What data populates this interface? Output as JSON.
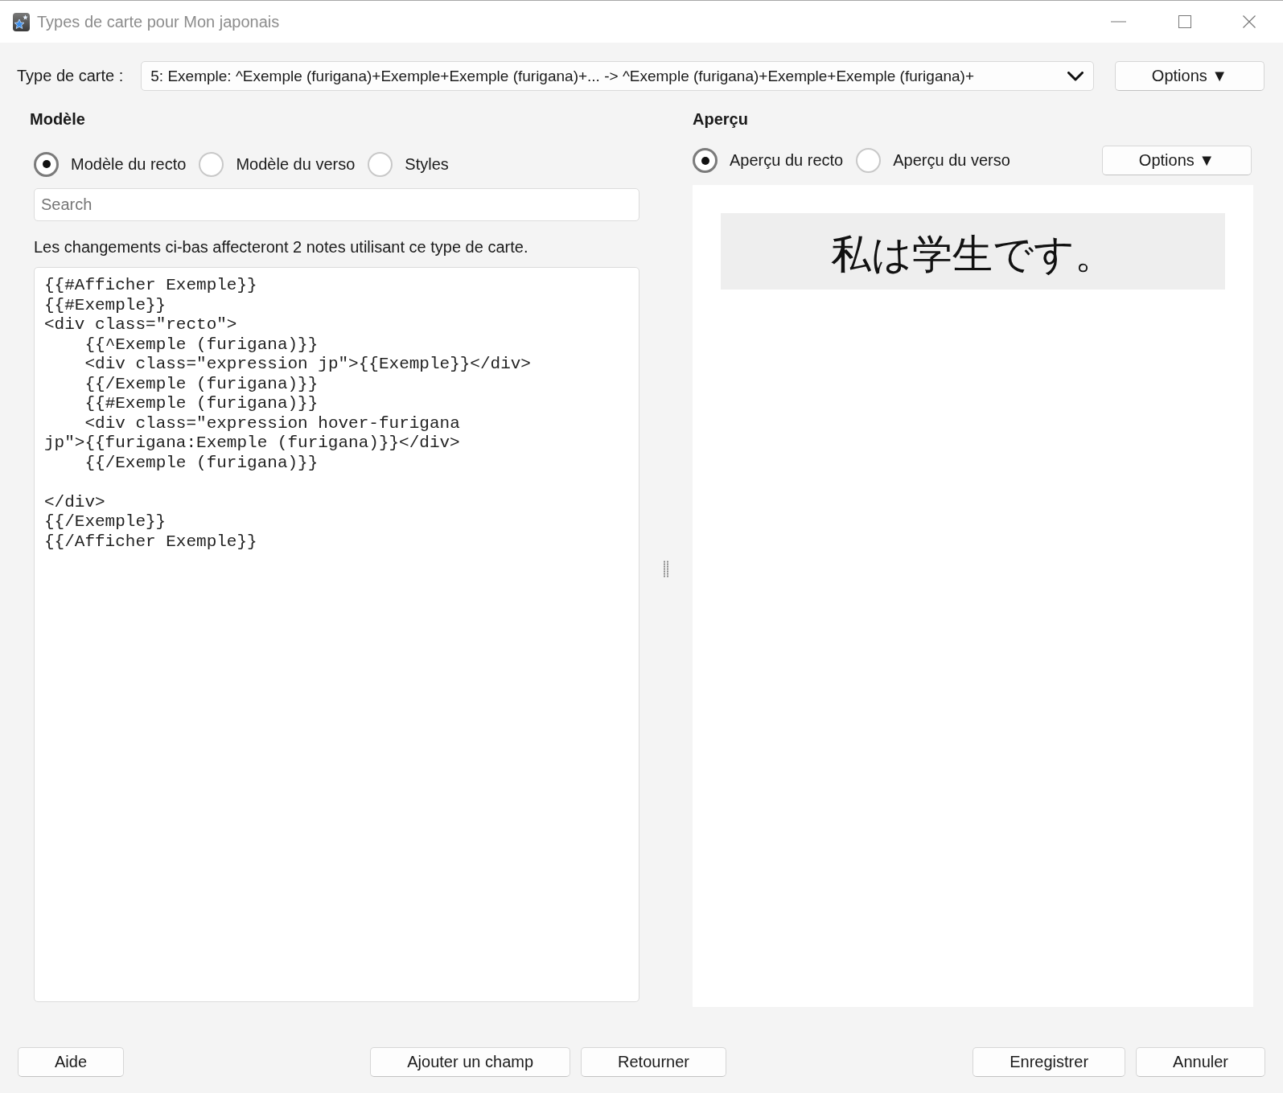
{
  "window": {
    "title": "Types de carte pour Mon japonais"
  },
  "card_type": {
    "label": "Type de carte :",
    "value": "5: Exemple: ^Exemple (furigana)+Exemple+Exemple (furigana)+... -> ^Exemple (furigana)+Exemple+Exemple (furigana)+",
    "options_button": "Options ▼"
  },
  "template": {
    "heading": "Modèle",
    "radios": [
      {
        "label": "Modèle du recto",
        "selected": true
      },
      {
        "label": "Modèle du verso",
        "selected": false
      },
      {
        "label": "Styles",
        "selected": false
      }
    ],
    "search": {
      "placeholder": "Search"
    },
    "notice": "Les changements ci-bas affecteront 2 notes utilisant ce type de carte.",
    "code": "{{#Afficher Exemple}}\n{{#Exemple}}\n<div class=\"recto\">\n    {{^Exemple (furigana)}}\n    <div class=\"expression jp\">{{Exemple}}</div>\n    {{/Exemple (furigana)}}\n    {{#Exemple (furigana)}}\n    <div class=\"expression hover-furigana jp\">{{furigana:Exemple (furigana)}}</div>\n    {{/Exemple (furigana)}}\n\n</div>\n{{/Exemple}}\n{{/Afficher Exemple}}"
  },
  "preview": {
    "heading": "Aperçu",
    "radios": [
      {
        "label": "Aperçu du recto",
        "selected": true
      },
      {
        "label": "Aperçu du verso",
        "selected": false
      }
    ],
    "options_button": "Options ▼",
    "card_text": "私は学生です。"
  },
  "footer": {
    "left": [
      "Aide"
    ],
    "center": [
      "Ajouter un champ",
      "Retourner"
    ],
    "right": [
      "Enregistrer",
      "Annuler"
    ]
  }
}
